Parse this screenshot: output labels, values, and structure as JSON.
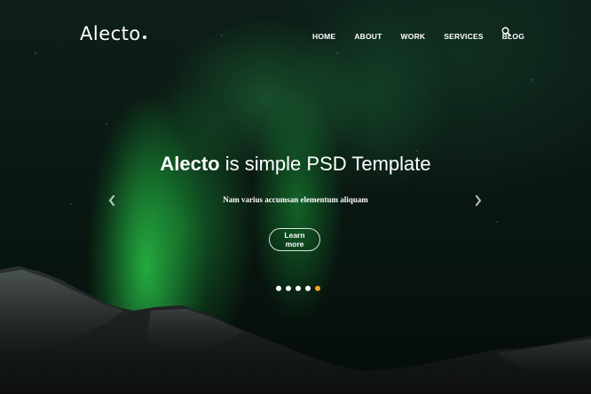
{
  "brand": {
    "name": "Alecto",
    "accent_color": "#f5a623"
  },
  "nav": {
    "items": [
      {
        "label": "HOME"
      },
      {
        "label": "ABOUT"
      },
      {
        "label": "WORK"
      },
      {
        "label": "SERVICES"
      },
      {
        "label": "BLOG"
      }
    ],
    "search_icon": "search-icon"
  },
  "hero": {
    "headline_strong": "Alecto",
    "headline_rest": " is simple PSD Template",
    "subtitle": "Nam varius accumsan elementum aliquam",
    "cta_label": "Learn more",
    "prev_icon": "chevron-left-icon",
    "next_icon": "chevron-right-icon"
  },
  "slider": {
    "slide_count": 5,
    "active_index": 4,
    "dot_color": "#ffffff",
    "active_dot_color": "#f5a623"
  }
}
